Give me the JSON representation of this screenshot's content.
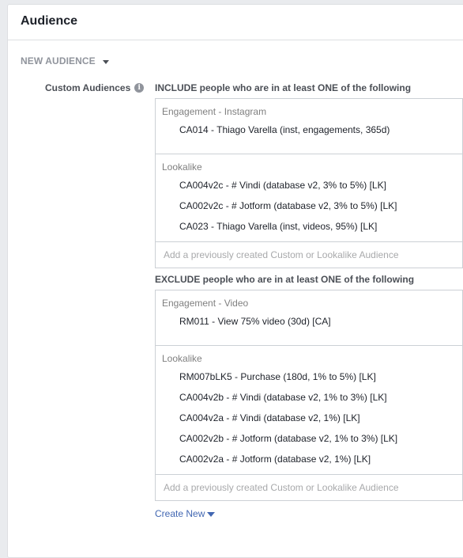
{
  "header": {
    "title": "Audience"
  },
  "new_audience": {
    "label": "NEW AUDIENCE"
  },
  "field": {
    "label": "Custom Audiences"
  },
  "include": {
    "title": "INCLUDE people who are in at least ONE of the following",
    "groups": [
      {
        "title": "Engagement - Instagram",
        "items": [
          "CA014 - Thiago Varella (inst, engagements, 365d)"
        ]
      },
      {
        "title": "Lookalike",
        "items": [
          "CA004v2c - # Vindi (database v2, 3% to 5%) [LK]",
          "CA002v2c - # Jotform (database v2, 3% to 5%) [LK]",
          "CA023 - Thiago Varella (inst, videos, 95%) [LK]"
        ]
      }
    ],
    "placeholder": "Add a previously created Custom or Lookalike Audience"
  },
  "exclude": {
    "title": "EXCLUDE people who are in at least ONE of the following",
    "groups": [
      {
        "title": "Engagement - Video",
        "items": [
          "RM011 - View 75% video (30d) [CA]"
        ]
      },
      {
        "title": "Lookalike",
        "items": [
          "RM007bLK5 - Purchase (180d, 1% to 5%) [LK]",
          "CA004v2b - # Vindi (database v2, 1% to 3%) [LK]",
          "CA004v2a - # Vindi (database v2, 1%) [LK]",
          "CA002v2b - # Jotform (database v2, 1% to 3%) [LK]",
          "CA002v2a - # Jotform (database v2, 1%) [LK]"
        ]
      }
    ],
    "placeholder": "Add a previously created Custom or Lookalike Audience"
  },
  "create_new": {
    "label": "Create New"
  },
  "icons": {
    "info": "info-icon",
    "dropdown": "caret-down-icon"
  },
  "colors": {
    "link": "#4267b2",
    "border": "#ccd0d5",
    "muted": "#90949c"
  }
}
